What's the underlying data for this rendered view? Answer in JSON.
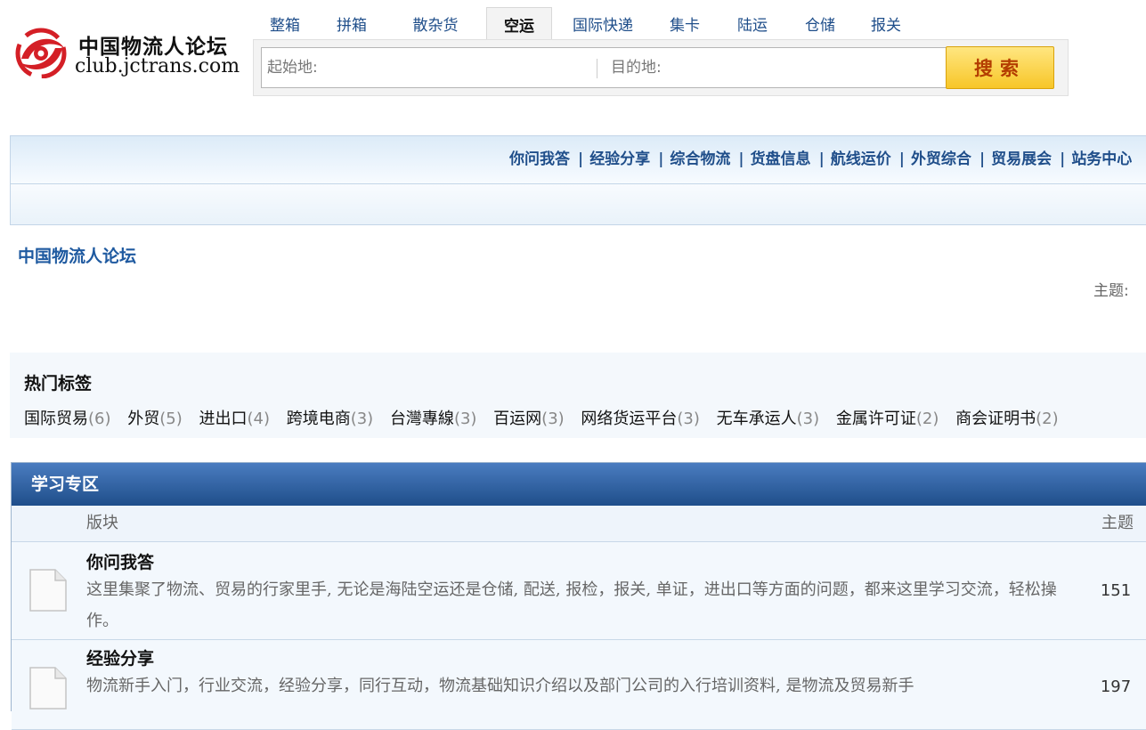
{
  "logo": {
    "name_cn": "中国物流人论坛",
    "domain": "club.jctrans.com",
    "brand_color": "#d41f26"
  },
  "category_tabs": [
    {
      "label": "整箱",
      "active": false
    },
    {
      "label": "拼箱",
      "active": false
    },
    {
      "label": "散杂货",
      "active": false
    },
    {
      "label": "空运",
      "active": true
    },
    {
      "label": "国际快递",
      "active": false
    },
    {
      "label": "集卡",
      "active": false
    },
    {
      "label": "陆运",
      "active": false
    },
    {
      "label": "仓储",
      "active": false
    },
    {
      "label": "报关",
      "active": false
    }
  ],
  "search": {
    "origin_placeholder": "起始地:",
    "origin_value": "",
    "destination_placeholder": "目的地:",
    "destination_value": "",
    "button_label": "搜索"
  },
  "nav": {
    "links": [
      "你问我答",
      "经验分享",
      "综合物流",
      "货盘信息",
      "航线运价",
      "外贸综合",
      "贸易展会",
      "站务中心"
    ],
    "separator": "|"
  },
  "page": {
    "forum_title": "中国物流人论坛",
    "topics_label": "主题:"
  },
  "hot_tags": {
    "title": "热门标签",
    "items": [
      {
        "name": "国际贸易",
        "count": "(6)"
      },
      {
        "name": "外贸",
        "count": "(5)"
      },
      {
        "name": "进出口",
        "count": "(4)"
      },
      {
        "name": "跨境电商",
        "count": "(3)"
      },
      {
        "name": "台灣專線",
        "count": "(3)"
      },
      {
        "name": "百运网",
        "count": "(3)"
      },
      {
        "name": "网络货运平台",
        "count": "(3)"
      },
      {
        "name": "无车承运人",
        "count": "(3)"
      },
      {
        "name": "金属许可证",
        "count": "(2)"
      },
      {
        "name": "商会证明书",
        "count": "(2)"
      }
    ]
  },
  "section": {
    "title": "学习专区",
    "col_board": "版块",
    "col_topics": "主题",
    "boards": [
      {
        "name": "你问我答",
        "desc": "这里集聚了物流、贸易的行家里手, 无论是海陆空运还是仓储, 配送, 报检，报关, 单证，进出口等方面的问题，都来这里学习交流，轻松操作。",
        "topics": "151"
      },
      {
        "name": "经验分享",
        "desc": "物流新手入门，行业交流，经验分享，同行互动，物流基础知识介绍以及部门公司的入行培训资料, 是物流及贸易新手",
        "topics": "197"
      }
    ]
  }
}
